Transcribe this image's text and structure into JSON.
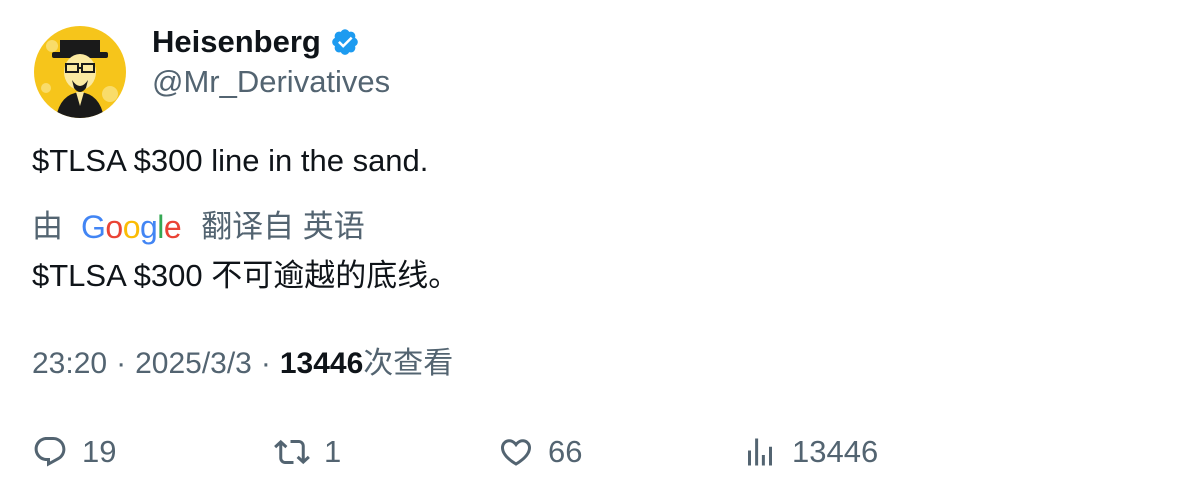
{
  "author": {
    "display_name": "Heisenberg",
    "handle": "@Mr_Derivatives",
    "verified": true,
    "verified_color": "#1d9bf0",
    "avatar_icon": "heisenberg-avatar-icon",
    "avatar_bg": "#f5c518"
  },
  "tweet": {
    "text": "$TLSA $300 line in the sand.",
    "translation_prefix": "由",
    "translation_provider": "Google",
    "translation_suffix": "翻译自 英语",
    "translated_text": "$TLSA $300 不可逾越的底线。"
  },
  "meta": {
    "time": "23:20",
    "separator": "·",
    "date": "2025/3/3",
    "views_count": "13446",
    "views_label": "次查看"
  },
  "actions": {
    "replies": "19",
    "retweets": "1",
    "likes": "66",
    "views": "13446"
  }
}
